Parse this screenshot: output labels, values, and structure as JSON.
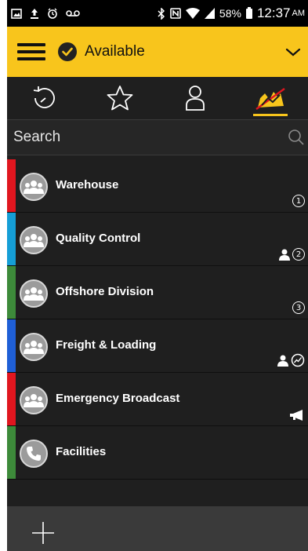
{
  "status_bar": {
    "battery": "58%",
    "time": "12:37",
    "ampm": "AM",
    "icons": [
      "gallery-icon",
      "upload-icon",
      "alarm-icon",
      "voicemail-icon",
      "bluetooth-icon",
      "nfc-icon",
      "wifi-icon",
      "signal-icon",
      "battery-icon"
    ]
  },
  "presence": {
    "label": "Available",
    "color": "#f8c51c"
  },
  "tabs": [
    {
      "name": "recent",
      "icon": "history-icon"
    },
    {
      "name": "favorites",
      "icon": "star-icon"
    },
    {
      "name": "contacts",
      "icon": "person-icon"
    },
    {
      "name": "channels",
      "icon": "channels-icon",
      "active": true
    }
  ],
  "search": {
    "placeholder": "Search"
  },
  "channels": [
    {
      "name": "Warehouse",
      "stripe": "#e0161f",
      "avatar": "group-icon",
      "badges": [
        "1"
      ]
    },
    {
      "name": "Quality Control",
      "stripe": "#159ed6",
      "avatar": "group-icon",
      "badges": [
        "person",
        "2"
      ]
    },
    {
      "name": "Offshore Division",
      "stripe": "#3d8a3a",
      "avatar": "group-icon",
      "badges": [
        "3"
      ]
    },
    {
      "name": "Freight & Loading",
      "stripe": "#1f5fd6",
      "avatar": "group-icon",
      "badges": [
        "person",
        "trend"
      ]
    },
    {
      "name": "Emergency Broadcast",
      "stripe": "#e0161f",
      "avatar": "group-icon",
      "badges": [
        "megaphone"
      ]
    },
    {
      "name": "Facilities",
      "stripe": "#3d8a3a",
      "avatar": "phone-icon",
      "badges": []
    }
  ],
  "bottom_bar": {
    "add_icon": "plus-icon"
  }
}
